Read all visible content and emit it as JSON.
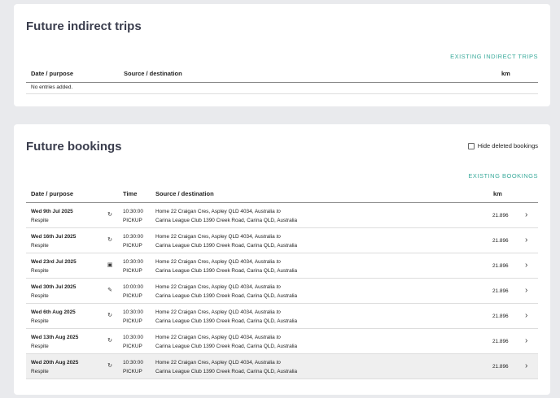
{
  "indirect": {
    "title": "Future indirect trips",
    "link": "EXISTING INDIRECT TRIPS",
    "columns": {
      "date": "Date / purpose",
      "source": "Source / destination",
      "km": "km"
    },
    "empty": "No entries added."
  },
  "bookings": {
    "title": "Future bookings",
    "hide_deleted": "Hide deleted bookings",
    "link": "EXISTING BOOKINGS",
    "columns": {
      "date": "Date / purpose",
      "time": "Time",
      "source": "Source / destination",
      "km": "km"
    },
    "rows": [
      {
        "date": "Wed 9th Jul 2025",
        "purpose": "Respite",
        "icon": "repeat-icon",
        "time": "10:30:00",
        "type": "PICKUP",
        "source": "Home 22 Craigan Cres, Aspley QLD 4034, Australia",
        "to": "to",
        "destination": "Carina League Club 1390 Creek Road, Carina QLD, Australia",
        "km": "21.896"
      },
      {
        "date": "Wed 16th Jul 2025",
        "purpose": "Respite",
        "icon": "repeat-icon",
        "time": "10:30:00",
        "type": "PICKUP",
        "source": "Home 22 Craigan Cres, Aspley QLD 4034, Australia",
        "to": "to",
        "destination": "Carina League Club 1390 Creek Road, Carina QLD, Australia",
        "km": "21.896"
      },
      {
        "date": "Wed 23rd Jul 2025",
        "purpose": "Respite",
        "icon": "calendar-icon",
        "time": "10:30:00",
        "type": "PICKUP",
        "source": "Home 22 Craigan Cres, Aspley QLD 4034, Australia",
        "to": "to",
        "destination": "Carina League Club 1390 Creek Road, Carina QLD, Australia",
        "km": "21.896"
      },
      {
        "date": "Wed 30th Jul 2025",
        "purpose": "Respite",
        "icon": "edit-icon",
        "time": "10:00:00",
        "type": "PICKUP",
        "source": "Home 22 Craigan Cres, Aspley QLD 4034, Australia",
        "to": "to",
        "destination": "Carina League Club 1390 Creek Road, Carina QLD, Australia",
        "km": "21.896"
      },
      {
        "date": "Wed 6th Aug 2025",
        "purpose": "Respite",
        "icon": "repeat-icon",
        "time": "10:30:00",
        "type": "PICKUP",
        "source": "Home 22 Craigan Cres, Aspley QLD 4034, Australia",
        "to": "to",
        "destination": "Carina League Club 1390 Creek Road, Carina QLD, Australia",
        "km": "21.896"
      },
      {
        "date": "Wed 13th Aug 2025",
        "purpose": "Respite",
        "icon": "repeat-icon",
        "time": "10:30:00",
        "type": "PICKUP",
        "source": "Home 22 Craigan Cres, Aspley QLD 4034, Australia",
        "to": "to",
        "destination": "Carina League Club 1390 Creek Road, Carina QLD, Australia",
        "km": "21.896"
      },
      {
        "date": "Wed 20th Aug 2025",
        "purpose": "Respite",
        "icon": "repeat-icon",
        "time": "10:30:00",
        "type": "PICKUP",
        "source": "Home 22 Craigan Cres, Aspley QLD 4034, Australia",
        "to": "to",
        "destination": "Carina League Club 1390 Creek Road, Carina QLD, Australia",
        "km": "21.896"
      }
    ]
  }
}
